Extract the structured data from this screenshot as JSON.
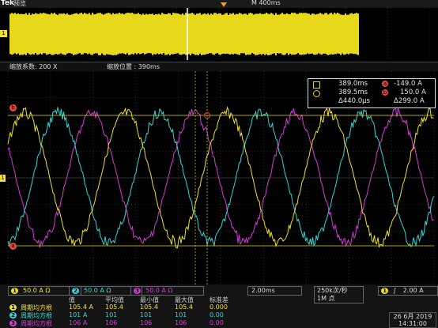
{
  "header": {
    "brand": "Tek",
    "mode": "预览",
    "record_length": "M 400ms"
  },
  "zoom": {
    "factor_label": "缩放系数: 200 X",
    "position_label": "缩放位置 : 390ms"
  },
  "overview_marker_label": "1",
  "cursors": {
    "a_time": "389.0ms",
    "b_time": "389.5ms",
    "delta_time": "Δ440.0µs",
    "a_value": "-149.0 A",
    "b_value": "150.0 A",
    "delta_value": "Δ299.0 A",
    "a_label": "a",
    "b_label": "b"
  },
  "channels": [
    {
      "num": "1",
      "scale": "50.0 A Ω",
      "color": "#f0e02a"
    },
    {
      "num": "2",
      "scale": "50.0 A Ω",
      "color": "#33d6d6"
    },
    {
      "num": "3",
      "scale": "50.0 A Ω",
      "color": "#d63ad6"
    }
  ],
  "horizontal": {
    "scale": "2.00ms",
    "sample_rate": "250k次/秒",
    "record": "1M 点"
  },
  "trigger": {
    "channel": "1",
    "slope": "∫",
    "level": "2.00 A"
  },
  "date": "26 6月 2019",
  "time": "14:31:00",
  "measurements": {
    "headers": [
      "值",
      "平均值",
      "最小值",
      "最大值",
      "标准差"
    ],
    "rows": [
      {
        "ch": "1",
        "name": "周期均方根",
        "value": "105.4 A",
        "mean": "105.4",
        "min": "105.4",
        "max": "105.4",
        "std": "0.000"
      },
      {
        "ch": "2",
        "name": "周期均方根",
        "value": "101 A",
        "mean": "101",
        "min": "101",
        "max": "101",
        "std": "0.00"
      },
      {
        "ch": "3",
        "name": "周期均方根",
        "value": "106 A",
        "mean": "106",
        "min": "106",
        "max": "106",
        "std": "0.00"
      }
    ]
  },
  "colors": {
    "ch1": "#f0e02a",
    "ch2": "#33d6d6",
    "ch3": "#d63ad6",
    "cursor": "#e04a3a",
    "accent": "#ff9a00"
  }
}
